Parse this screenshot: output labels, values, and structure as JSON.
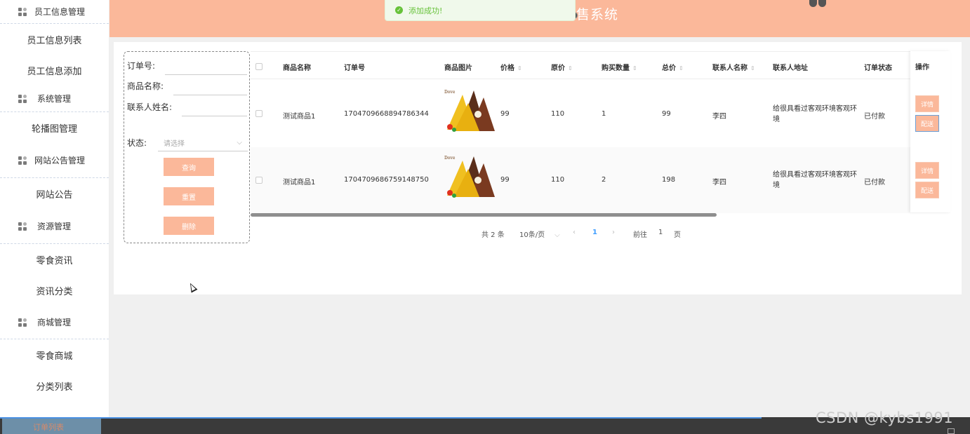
{
  "sidebar": {
    "items": [
      {
        "type": "group",
        "label": "员工信息管理"
      },
      {
        "type": "item",
        "label": "员工信息列表"
      },
      {
        "type": "item",
        "label": "员工信息添加"
      },
      {
        "type": "group",
        "label": "系统管理"
      },
      {
        "type": "item",
        "label": "轮播图管理"
      },
      {
        "type": "group",
        "label": "网站公告管理"
      },
      {
        "type": "item",
        "label": "网站公告"
      },
      {
        "type": "group",
        "label": "资源管理"
      },
      {
        "type": "item",
        "label": "零食资讯"
      },
      {
        "type": "item",
        "label": "资讯分类"
      },
      {
        "type": "group",
        "label": "商城管理"
      },
      {
        "type": "item",
        "label": "零食商城"
      },
      {
        "type": "item",
        "label": "分类列表"
      },
      {
        "type": "item",
        "label": "订单列表",
        "active": true
      }
    ]
  },
  "header": {
    "title": "售系统",
    "bg_color": "#fbb89a"
  },
  "toast": {
    "message": "添加成功!",
    "icon": "check-circle-icon"
  },
  "search": {
    "order_no_label": "订单号:",
    "product_name_label": "商品名称:",
    "contact_name_label": "联系人姓名:",
    "status_label": "状态:",
    "status_placeholder": "请选择",
    "query_button": "查询",
    "reset_button": "重置",
    "delete_button": "删除"
  },
  "table": {
    "headers": {
      "product_name": "商品名称",
      "order_no": "订单号",
      "product_image": "商品图片",
      "price": "价格",
      "original_price": "原价",
      "quantity": "购买数量",
      "total": "总价",
      "contact_name": "联系人名称",
      "contact_address": "联系人地址",
      "status": "订单状态",
      "actions": "操作"
    },
    "image_brand_text": "Dove",
    "rows": [
      {
        "product_name": "测试商品1",
        "order_no": "1704709668894786344",
        "price": "99",
        "original_price": "110",
        "quantity": "1",
        "total": "99",
        "contact_name": "李四",
        "contact_address": "给很具看过客观环境客观环境",
        "status": "已付款",
        "detail_button": "详情",
        "ship_button": "配送"
      },
      {
        "product_name": "测试商品1",
        "order_no": "1704709686759148750",
        "price": "99",
        "original_price": "110",
        "quantity": "2",
        "total": "198",
        "contact_name": "李四",
        "contact_address": "给很具看过客观环境客观环境",
        "status": "已付款",
        "detail_button": "详情",
        "ship_button": "配送"
      }
    ]
  },
  "pagination": {
    "total": "共 2 条",
    "page_size": "10条/页",
    "current_page": "1",
    "goto_label": "前往",
    "goto_value": "1",
    "page_suffix": "页",
    "active_color": "#409eff"
  },
  "taskbar": {
    "active_label": "订单列表"
  },
  "watermark": "CSDN @kybs1991"
}
